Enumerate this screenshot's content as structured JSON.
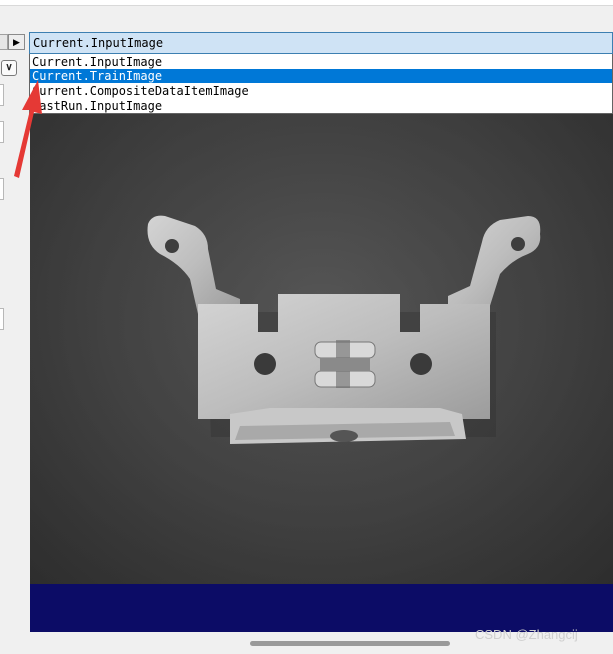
{
  "combo": {
    "selected_value": "Current.InputImage"
  },
  "dropdown": {
    "options": [
      "Current.InputImage",
      "Current.TrainImage",
      "Current.CompositeDataItemImage",
      "LastRun.InputImage"
    ],
    "highlighted_option": "Current.TrainImage"
  },
  "nav": {
    "next_icon": "triangle-right-icon",
    "expand_icon": "double-chevron-down-icon"
  },
  "viewer": {
    "content": "grayscale-image-of-metal-bracket",
    "footer_color": "#0c0c66"
  },
  "annotation": {
    "arrow_color": "#e53935"
  },
  "watermark": {
    "text": "CSDN @Zhangcij"
  },
  "colors": {
    "selection": "#0078d7",
    "combo_bg": "#cfe3f5",
    "combo_border": "#3c7fb1"
  }
}
